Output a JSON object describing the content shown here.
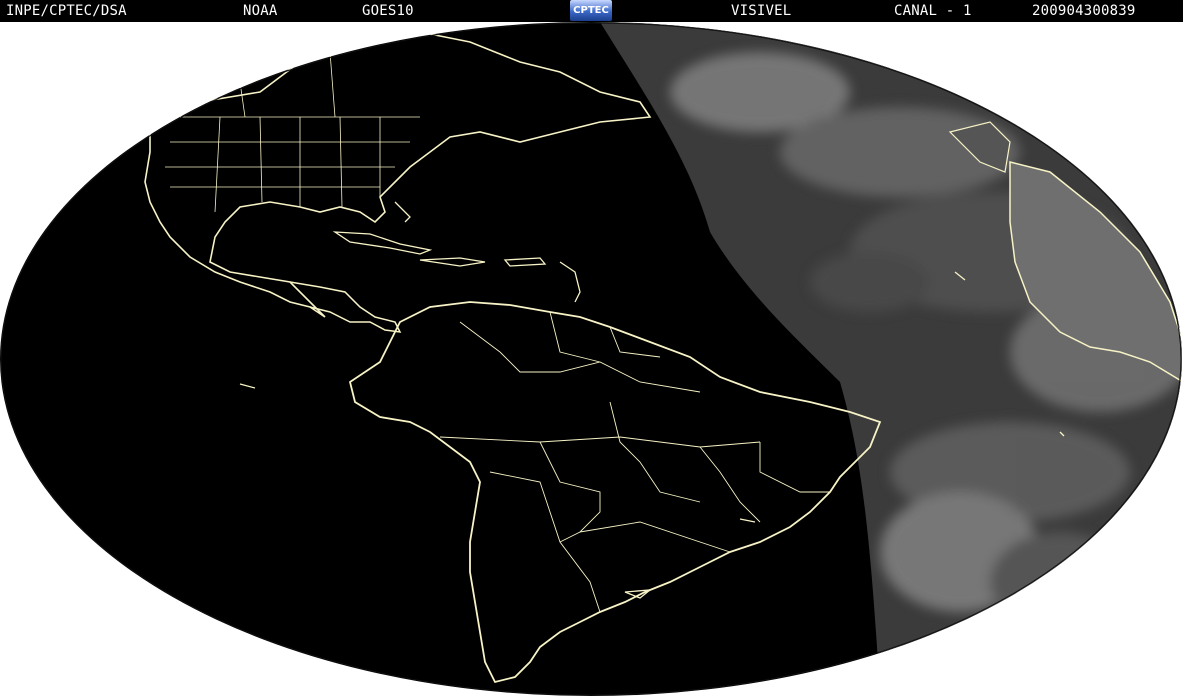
{
  "header": {
    "agency": "INPE/CPTEC/DSA",
    "source": "NOAA",
    "satellite": "GOES10",
    "logo_text": "CPTEC",
    "band": "VISIVEL",
    "channel": "CANAL - 1",
    "timestamp": "200904300839"
  },
  "colors": {
    "header_bg": "#000000",
    "globe_night": "#000000",
    "globe_day": "#3a3a3a",
    "coastline": "#f7f3c6",
    "clouds": "#bfbfbf"
  },
  "icons": [
    "cptec-logo"
  ]
}
